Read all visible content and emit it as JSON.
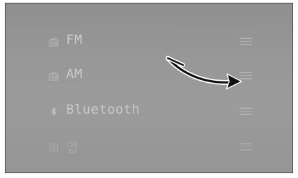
{
  "menu": {
    "items": [
      {
        "label": "FM",
        "icon": "radio-icon"
      },
      {
        "label": "AM",
        "icon": "radio-icon"
      },
      {
        "label": "Bluetooth",
        "icon": "bluetooth-icon"
      },
      {
        "label": "앱",
        "icon": "apps-grid-icon"
      }
    ]
  },
  "annotation": {
    "icon": "curved-arrow-icon",
    "color": "#111111"
  },
  "colors": {
    "background": "#969696",
    "text": "#c9c9c9",
    "handle": "#b4b4b4"
  }
}
